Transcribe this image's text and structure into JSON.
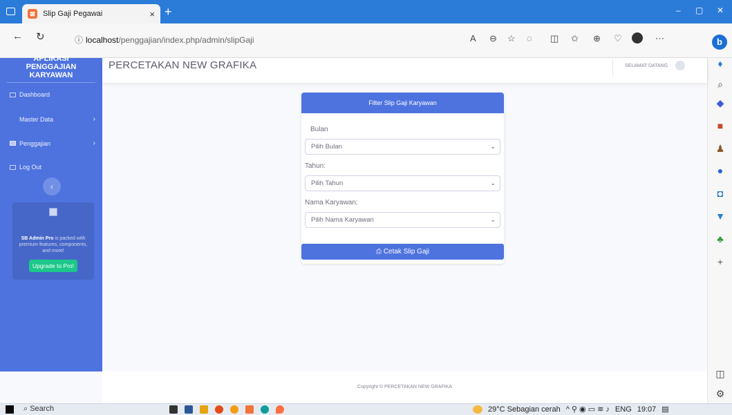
{
  "browser": {
    "tab_title": "Slip Gaji Pegawai",
    "tab_close": "×",
    "new_tab": "+",
    "url_host": "localhost",
    "url_path": "/penggajian/index.php/admin/slipGaji",
    "win_min": "–",
    "win_max": "▢",
    "win_close": "✕"
  },
  "sidebar": {
    "brand_line1": "APLIKASI",
    "brand_line2": "PENGGAJIAN",
    "brand_line3": "KARYAWAN",
    "items": [
      {
        "label": "Dashboard"
      },
      {
        "label": "Master Data"
      },
      {
        "label": "Penggajian"
      },
      {
        "label": "Log Out"
      }
    ],
    "promo_brand": "SB Admin Pro",
    "promo_text": " is packed with premium features, components, and more!",
    "promo_button": "Upgrade to Pro!"
  },
  "topbar": {
    "company": "PERCETAKAN NEW GRAFIKA",
    "welcome": "SELAMAT DATANG"
  },
  "form": {
    "header": "Filter Slip Gaji Karyawan",
    "bulan_label": "Bulan",
    "bulan_value": "Pilih Bulan",
    "tahun_label": "Tahun:",
    "tahun_value": "Pilih Tahun",
    "nama_label": "Nama Karyawan:",
    "nama_value": "Pilih Nama Karyawan",
    "print_button": "Cetak Slip Gaji"
  },
  "footer": {
    "copyright": "Copyright © PERCETAKAN NEW GRAFIKA"
  },
  "taskbar": {
    "search": "Search",
    "weather": "29°C  Sebagian cerah",
    "lang": "ENG",
    "time": "19:07"
  },
  "colors": {
    "primary": "#4e73df",
    "success": "#1cc88a",
    "browser_blue": "#2b7bd8"
  }
}
